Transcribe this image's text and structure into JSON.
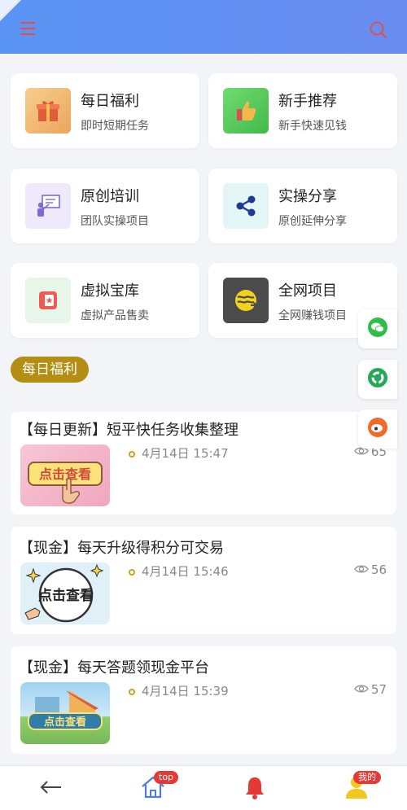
{
  "categories": [
    {
      "title": "每日福利",
      "subtitle": "即时短期任务",
      "icon": "gift-icon"
    },
    {
      "title": "新手推荐",
      "subtitle": "新手快速见钱",
      "icon": "thumbs-up-icon"
    },
    {
      "title": "原创培训",
      "subtitle": "团队实操项目",
      "icon": "training-icon"
    },
    {
      "title": "实操分享",
      "subtitle": "原创延伸分享",
      "icon": "share-icon"
    },
    {
      "title": "虚拟宝库",
      "subtitle": "虚拟产品售卖",
      "icon": "treasure-icon"
    },
    {
      "title": "全网项目",
      "subtitle": "全网赚钱项目",
      "icon": "globe-icon"
    }
  ],
  "section": {
    "label": "每日福利"
  },
  "articles": [
    {
      "title": "【每日更新】短平快任务收集整理",
      "time": "4月14日 15:47",
      "views": "65",
      "thumb_text": "点击查看"
    },
    {
      "title": "【现金】每天升级得积分可交易",
      "time": "4月14日 15:46",
      "views": "56",
      "thumb_text": "点击查看"
    },
    {
      "title": "【现金】每天答题领现金平台",
      "time": "4月14日 15:39",
      "views": "57",
      "thumb_text": "点击查看"
    }
  ],
  "bottom_nav": {
    "home_badge": "top",
    "profile_badge": "我的"
  },
  "colors": {
    "header_gradient_start": "#5a95f5",
    "header_gradient_end": "#6a8cf0",
    "section_badge": "#b38e12",
    "accent_red": "#e53935"
  }
}
